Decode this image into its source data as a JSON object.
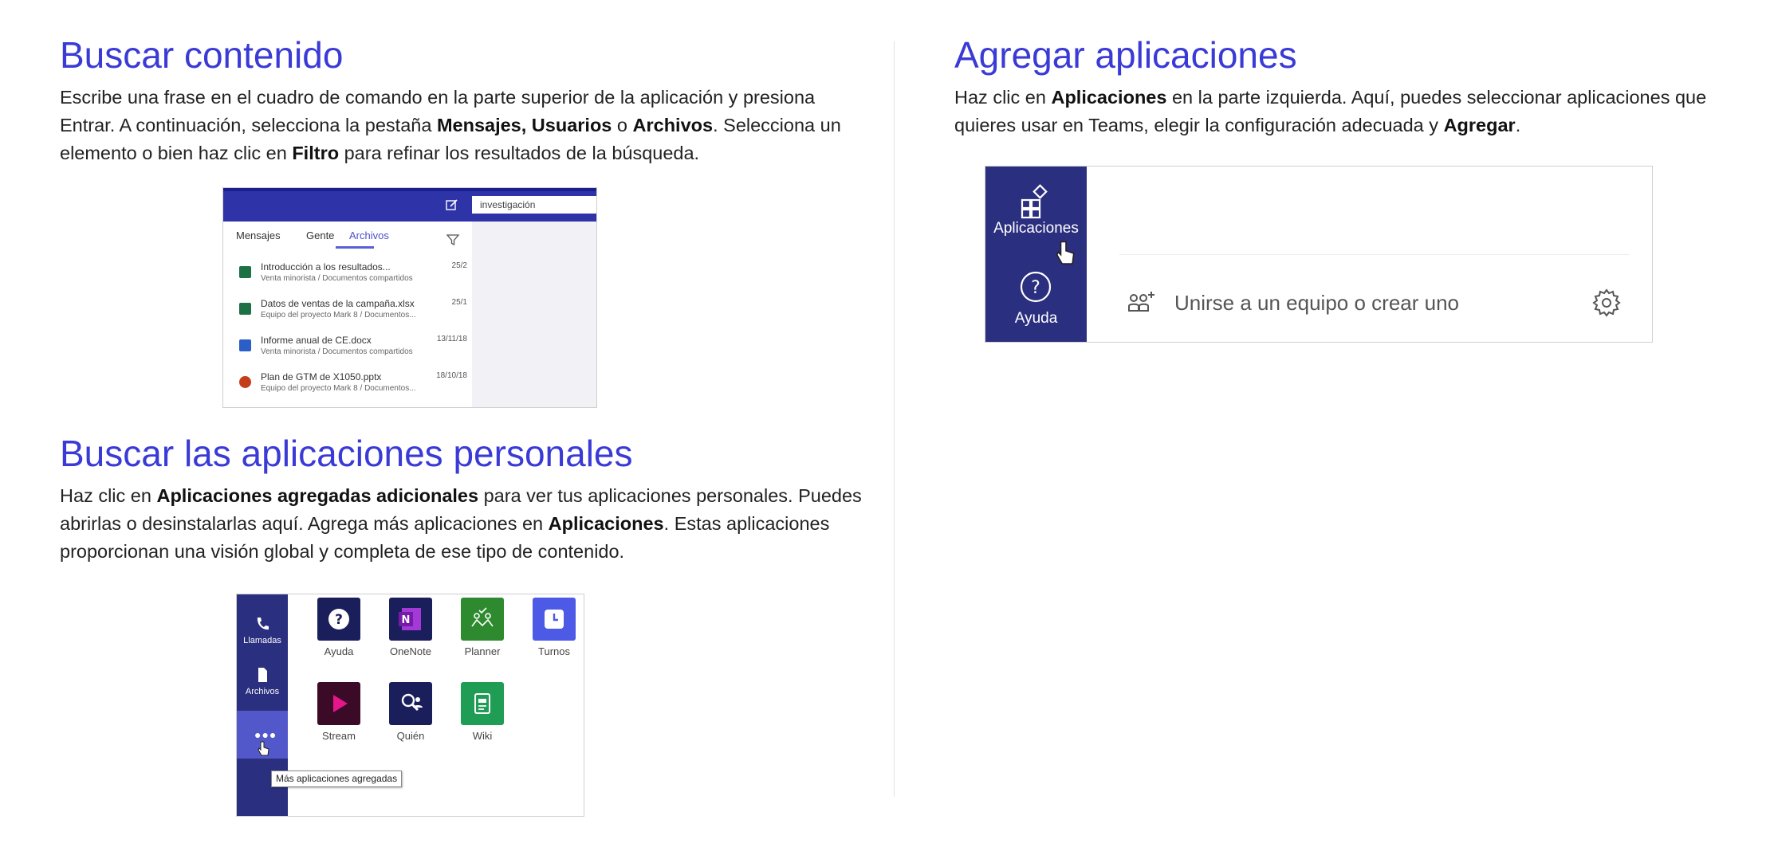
{
  "search_section": {
    "title": "Buscar contenido",
    "p1": "Escribe una frase en el cuadro de comando en la parte superior de la aplicación y presiona Entrar. A continuación, selecciona la pestaña ",
    "b1": "Mensajes, Usuarios",
    "p2": " o ",
    "b2": "Archivos",
    "p3": ". Selecciona un elemento o bien haz clic en ",
    "b3": "Filtro",
    "p4": " para refinar los resultados de la búsqueda.",
    "screenshot": {
      "search_value": "investigación",
      "tabs": [
        "Mensajes",
        "Gente",
        "Archivos"
      ],
      "active_tab": "Archivos",
      "results": [
        {
          "name": "Introducción a los resultados...",
          "sub": "Venta minorista / Documentos compartidos",
          "date": "25/2",
          "type": "excel"
        },
        {
          "name": "Datos de ventas de la campaña.xlsx",
          "sub": "Equipo del proyecto Mark 8 / Documentos...",
          "date": "25/1",
          "type": "excel"
        },
        {
          "name": "Informe anual de CE.docx",
          "sub": "Venta minorista / Documentos compartidos",
          "date": "13/11/18",
          "type": "word"
        },
        {
          "name": "Plan de GTM de X1050.pptx",
          "sub": "Equipo del proyecto Mark 8 / Documentos...",
          "date": "18/10/18",
          "type": "powerpoint"
        }
      ]
    }
  },
  "personal_apps_section": {
    "title": "Buscar las aplicaciones personales",
    "p1": "Haz clic en ",
    "b1": "Aplicaciones agregadas adicionales",
    "p2": " para ver tus aplicaciones personales. Puedes abrirlas o desinstalarlas aquí. Agrega más aplicaciones en ",
    "b2": "Aplicaciones",
    "p3": ". Estas aplicaciones proporcionan una visión global y completa de ese tipo de contenido.",
    "screenshot": {
      "rail": [
        "Llamadas",
        "Archivos"
      ],
      "tooltip": "Más aplicaciones agregadas",
      "apps": [
        "Ayuda",
        "OneNote",
        "Planner",
        "Turnos",
        "Stream",
        "Quién",
        "Wiki"
      ]
    }
  },
  "add_apps_section": {
    "title": "Agregar aplicaciones",
    "p1": "Haz clic en ",
    "b1": "Aplicaciones",
    "p2": " en la parte izquierda. Aquí, puedes seleccionar aplicaciones que quieres usar en Teams, elegir la configuración adecuada y ",
    "b2": "Agregar",
    "p3": ".",
    "screenshot": {
      "rail": [
        "Aplicaciones",
        "Ayuda"
      ],
      "join_text": "Unirse a un equipo o crear uno"
    }
  },
  "colors": {
    "heading": "#3a3ad6",
    "teams_rail": "#2b2f7f",
    "teams_bar": "#2f33a8"
  }
}
